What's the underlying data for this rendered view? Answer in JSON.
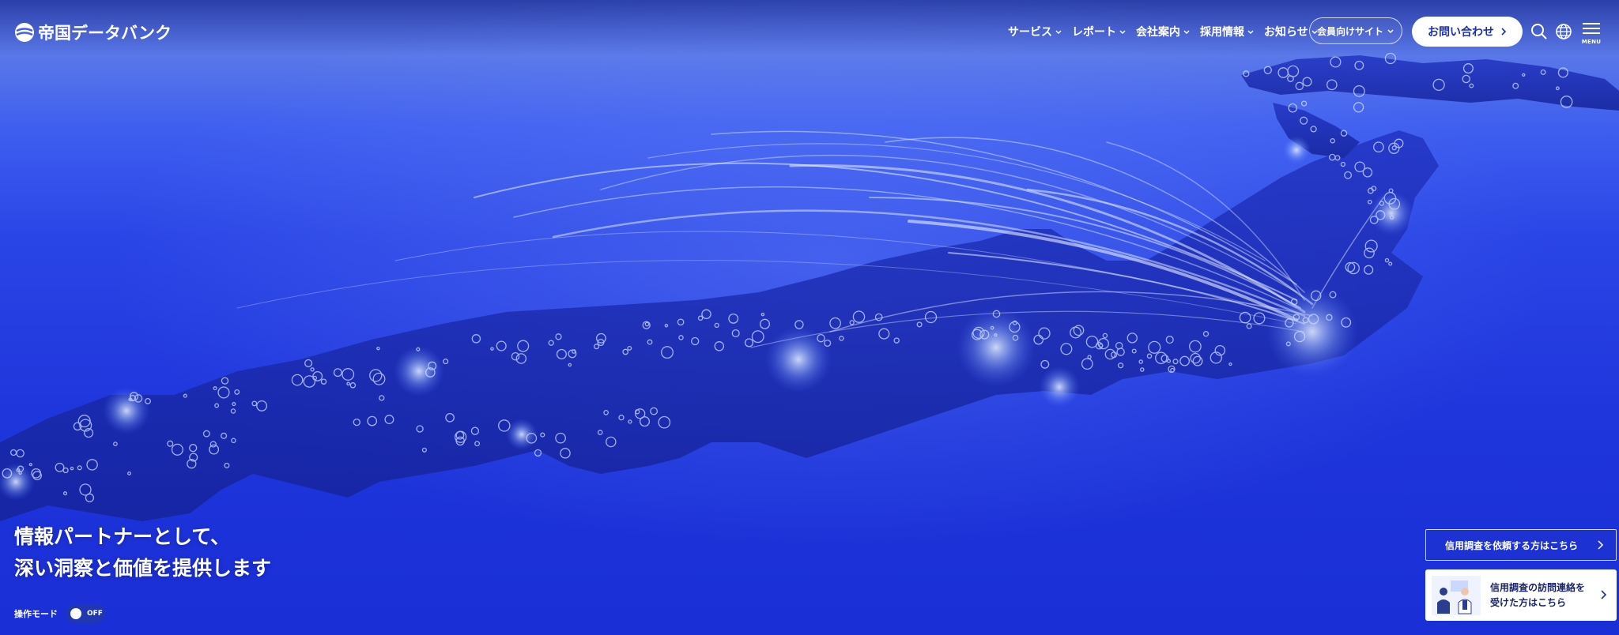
{
  "header": {
    "logo_text": "帝国データバンク",
    "nav": [
      {
        "label": "サービス"
      },
      {
        "label": "レポート"
      },
      {
        "label": "会社案内"
      },
      {
        "label": "採用情報"
      },
      {
        "label": "お知らせ"
      }
    ],
    "member_site": "会員向けサイト",
    "contact": "お問い合わせ",
    "search_icon": "search-icon",
    "language_icon": "globe-icon",
    "menu_label": "MENU"
  },
  "hero": {
    "headline_line1": "情報パートナーとして、",
    "headline_line2": "深い洞察と価値を提供します"
  },
  "operation_mode": {
    "label": "操作モード",
    "state": "OFF"
  },
  "side_links": {
    "credit_request": "信用調査を依頼する方はこちら",
    "visit_line1": "信用調査の訪問連絡を",
    "visit_line2": "受けた方はこちら"
  },
  "colors": {
    "brand_blue": "#1b2fb4",
    "hero_blue": "#1f36dc"
  }
}
